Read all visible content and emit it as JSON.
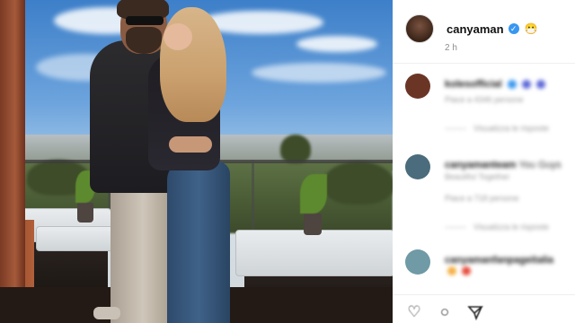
{
  "post": {
    "username": "canyaman",
    "verified_mark": "✓",
    "emoji": "😷",
    "time_ago": "2 h"
  },
  "comments": [
    {
      "username": "kolesofficial",
      "text": "",
      "meta": "Piace a 4346 persone",
      "reply": "Visualizza le risposte",
      "avatar_color": "#6b3526"
    },
    {
      "username": "canyamanteam",
      "text": "You Guys",
      "text2": "Beautiful Together",
      "meta": "Piace a 718 persone",
      "reply": "Visualizza le risposte",
      "avatar_color": "#4a6c7c"
    },
    {
      "username": "canyamanfanpageitalia",
      "text": "",
      "meta": "",
      "reply": "",
      "avatar_color": "#6f9aa6"
    }
  ],
  "actions": {
    "like_icon": "heart-icon",
    "comment_icon": "comment-icon",
    "share_icon": "share-icon"
  }
}
